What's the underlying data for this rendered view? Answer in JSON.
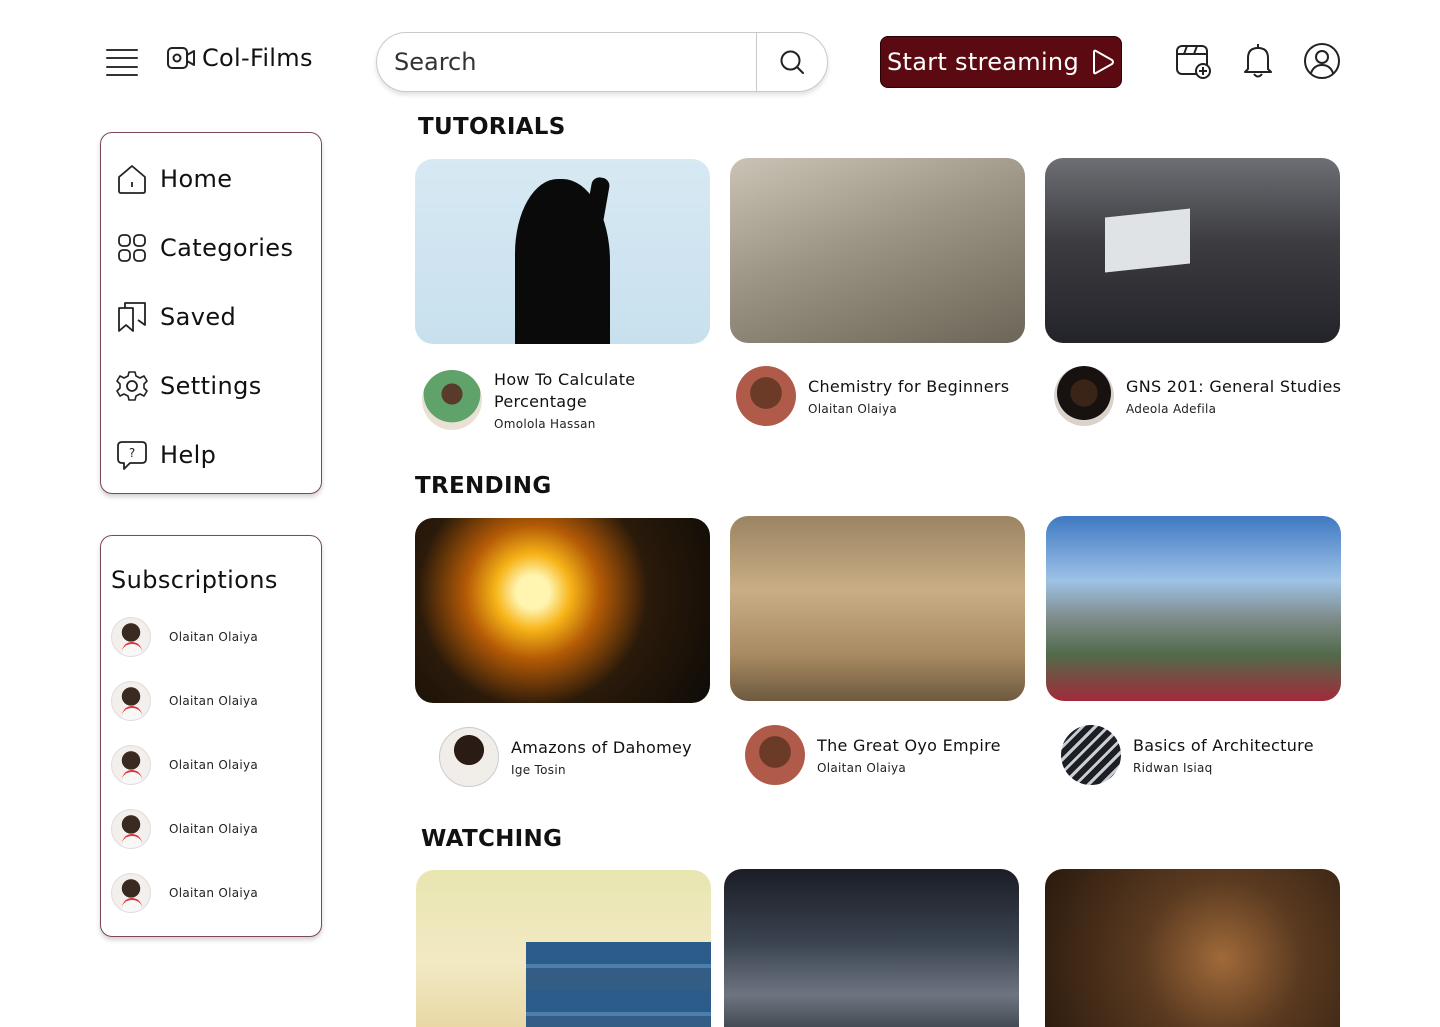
{
  "app": {
    "name": "Col-Films"
  },
  "header": {
    "search_placeholder": "Search",
    "stream_button": "Start streaming"
  },
  "sidebar": {
    "items": [
      {
        "label": "Home",
        "icon": "home-icon"
      },
      {
        "label": "Categories",
        "icon": "categories-icon"
      },
      {
        "label": "Saved",
        "icon": "saved-icon"
      },
      {
        "label": "Settings",
        "icon": "settings-icon"
      },
      {
        "label": "Help",
        "icon": "help-icon"
      }
    ]
  },
  "subscriptions": {
    "title": "Subscriptions",
    "channels": [
      {
        "name": "Olaitan Olaiya"
      },
      {
        "name": "Olaitan Olaiya"
      },
      {
        "name": "Olaitan Olaiya"
      },
      {
        "name": "Olaitan Olaiya"
      },
      {
        "name": "Olaitan Olaiya"
      }
    ]
  },
  "sections": {
    "tutorials": {
      "title": "TUTORIALS",
      "videos": [
        {
          "title": "How To Calculate Percentage",
          "channel": "Omolola Hassan"
        },
        {
          "title": "Chemistry for Beginners",
          "channel": "Olaitan Olaiya"
        },
        {
          "title": "GNS 201: General Studies",
          "channel": "Adeola Adefila"
        }
      ]
    },
    "trending": {
      "title": "TRENDING",
      "videos": [
        {
          "title": "Amazons of Dahomey",
          "channel": "Ige Tosin"
        },
        {
          "title": "The Great Oyo Empire",
          "channel": "Olaitan Olaiya"
        },
        {
          "title": "Basics of Architecture",
          "channel": "Ridwan Isiaq"
        }
      ]
    },
    "watching": {
      "title": "WATCHING"
    }
  },
  "colors": {
    "accent": "#5a0a10",
    "card_border": "#7a4a55"
  }
}
